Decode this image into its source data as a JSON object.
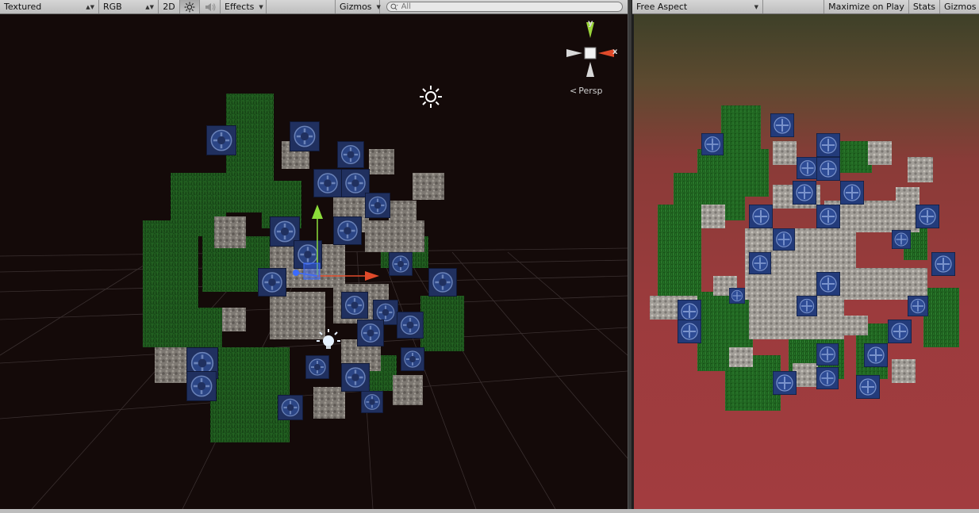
{
  "scene_toolbar": {
    "draw_mode": "Textured",
    "render_mode": "RGB",
    "mode_2d": "2D",
    "effects": "Effects",
    "gizmos": "Gizmos",
    "search_placeholder": "All"
  },
  "game_toolbar": {
    "aspect": "Free Aspect",
    "maximize": "Maximize on Play",
    "stats": "Stats",
    "gizmos": "Gizmos"
  },
  "scene_view": {
    "projection_label": "Persp",
    "axis_x": "x",
    "axis_y": "y"
  },
  "colors": {
    "scene_bg": "#140a09",
    "grass": "#1f5a1f",
    "stone": "#8a8580",
    "blue_crate": "#23386e",
    "game_bg": "#9c3b3d"
  }
}
